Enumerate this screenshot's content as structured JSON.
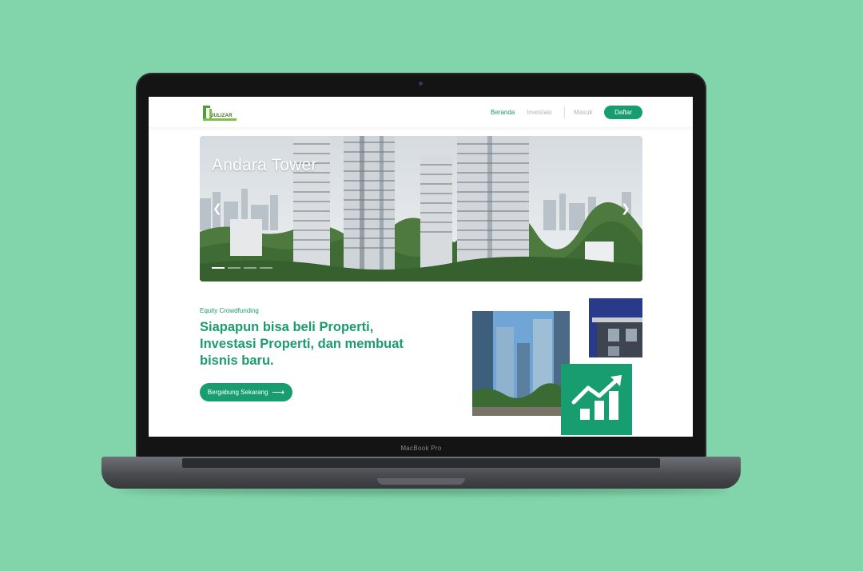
{
  "laptop": {
    "model_label": "MacBook Pro"
  },
  "nav": {
    "logo_text": "JULIZAR",
    "links": [
      "Beranda",
      "Investasi",
      "Masuk"
    ],
    "cta_label": "Daftar"
  },
  "hero": {
    "title": "Andara Tower",
    "prev_icon": "chevron-left-icon",
    "next_icon": "chevron-right-icon",
    "slides_total": 4,
    "active_slide": 1
  },
  "intro": {
    "eyebrow": "Equity Crowdfunding",
    "headline": "Siapapun bisa beli Properti, Investasi Properti, dan membuat bisnis baru.",
    "cta_label": "Bergabung Sekarang",
    "cta_icon": "arrow-right-icon"
  },
  "colors": {
    "background": "#82d5aa",
    "brand": "#179d6f"
  }
}
